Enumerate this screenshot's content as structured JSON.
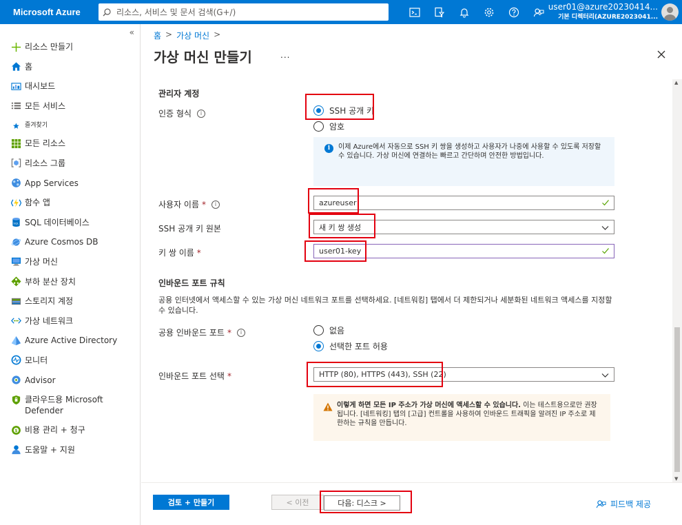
{
  "topbar": {
    "brand": "Microsoft Azure",
    "search_placeholder": "리소스, 서비스 및 문서 검색(G+/)",
    "icons": [
      "cloud-shell-icon",
      "directory-filter-icon",
      "notifications-icon",
      "settings-icon",
      "help-icon",
      "feedback-icon"
    ],
    "user": "user01@azure20230414...",
    "directory": "기본 디렉터리(AZURE2023041..."
  },
  "sidebar": {
    "collapse": "«",
    "items": [
      {
        "label": "리소스 만들기",
        "icon": "plus-icon"
      },
      {
        "label": "홈",
        "icon": "home-icon"
      },
      {
        "label": "대시보드",
        "icon": "dashboard-icon"
      },
      {
        "label": "모든 서비스",
        "icon": "all-services-icon"
      },
      {
        "label": "즐겨찾기",
        "icon": "star-icon"
      },
      {
        "label": "모든 리소스",
        "icon": "all-resources-icon"
      },
      {
        "label": "리소스 그룹",
        "icon": "resource-group-icon"
      },
      {
        "label": "App Services",
        "icon": "app-services-icon"
      },
      {
        "label": "함수 앱",
        "icon": "function-app-icon"
      },
      {
        "label": "SQL 데이터베이스",
        "icon": "sql-database-icon"
      },
      {
        "label": "Azure Cosmos DB",
        "icon": "cosmos-db-icon"
      },
      {
        "label": "가상 머신",
        "icon": "virtual-machine-icon"
      },
      {
        "label": "부하 분산 장치",
        "icon": "load-balancer-icon"
      },
      {
        "label": "스토리지 계정",
        "icon": "storage-account-icon"
      },
      {
        "label": "가상 네트워크",
        "icon": "virtual-network-icon"
      },
      {
        "label": "Azure Active Directory",
        "icon": "active-directory-icon"
      },
      {
        "label": "모니터",
        "icon": "monitor-icon"
      },
      {
        "label": "Advisor",
        "icon": "advisor-icon"
      },
      {
        "label": "클라우드용 Microsoft Defender",
        "icon": "defender-icon"
      },
      {
        "label": "비용 관리 + 청구",
        "icon": "cost-management-icon"
      },
      {
        "label": "도움말 + 지원",
        "icon": "help-support-icon"
      }
    ]
  },
  "main": {
    "breadcrumb": [
      "홈",
      "가상 머신"
    ],
    "title": "가상 머신 만들기",
    "more": "...",
    "admin": {
      "heading": "관리자 계정",
      "auth_label": "인증 형식",
      "auth_options": [
        "SSH 공개 키",
        "암호"
      ],
      "auth_selected": "SSH 공개 키",
      "info": "이제 Azure에서 자동으로 SSH 키 쌍을 생성하고 사용자가 나중에 사용할 수 있도록 저장할 수 있습니다. 가상 머신에 연결하는 빠르고 간단하며 안전한 방법입니다.",
      "username_label": "사용자 이름",
      "username_value": "azureuser",
      "ssh_source_label": "SSH 공개 키 원본",
      "ssh_source_value": "새 키 쌍 생성",
      "keypair_label": "키 쌍 이름",
      "keypair_value": "user01-key"
    },
    "inbound": {
      "heading": "인바운드 포트 규칙",
      "description": "공용 인터넷에서 액세스할 수 있는 가상 머신 네트워크 포트를 선택하세요. [네트워킹] 탭에서 더 제한되거나 세분화된 네트워크 액세스를 지정할 수 있습니다.",
      "public_ports_label": "공용 인바운드 포트",
      "public_ports_options": [
        "없음",
        "선택한 포트 허용"
      ],
      "public_ports_selected": "선택한 포트 허용",
      "select_ports_label": "인바운드 포트 선택",
      "select_ports_value": "HTTP (80), HTTPS (443), SSH (22)",
      "warning_bold": "이렇게 하면 모든 IP 주소가 가상 머신에 액세스할 수 있습니다.",
      "warning_text": "이는 테스트용으로만 권장됩니다. [네트워킹] 탭의 [고급] 컨트롤을 사용하여 인바운드 트래픽을 알려진 IP 주소로 제한하는 규칙을 만듭니다."
    },
    "required_mark": "*",
    "info_glyph": "i"
  },
  "footer": {
    "review_create": "검토 + 만들기",
    "previous": "< 이전",
    "next": "다음: 디스크 >",
    "feedback": "피드백 제공"
  },
  "colors": {
    "accent": "#0078d4",
    "highlight": "#e3000f"
  }
}
